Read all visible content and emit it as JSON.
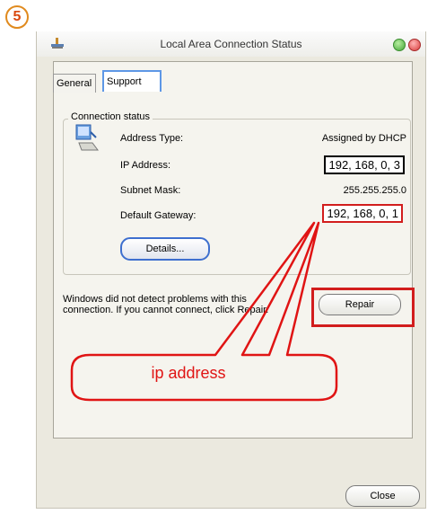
{
  "step_badge": "5",
  "window": {
    "title": "Local Area Connection Status",
    "tabs": [
      {
        "label": "General"
      },
      {
        "label": "Support"
      }
    ]
  },
  "connection_status": {
    "legend": "Connection status",
    "rows": [
      {
        "label": "Address Type:",
        "value": "Assigned by DHCP"
      },
      {
        "label": "IP Address:",
        "value": "192, 168, 0, 3"
      },
      {
        "label": "Subnet Mask:",
        "value": "255.255.255.0"
      },
      {
        "label": "Default Gateway:",
        "value": "192, 168, 0, 1"
      }
    ],
    "details_button": "Details..."
  },
  "diagnosis": {
    "message": "Windows did not detect problems with this connection. If you cannot connect, click Repair.",
    "repair_button": "Repair"
  },
  "annotation": {
    "callout_text": "ip address",
    "color": "#e01414"
  },
  "footer": {
    "close_button": "Close"
  }
}
